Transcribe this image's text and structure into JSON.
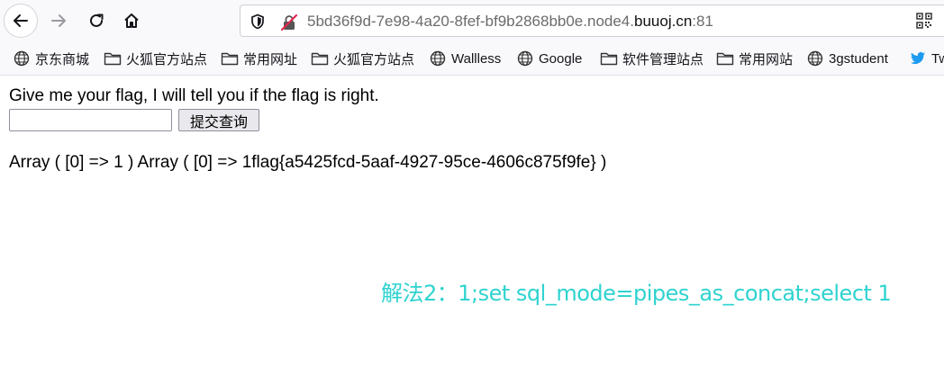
{
  "browser": {
    "url_prefix": "5bd36f9d-7e98-4a20-8fef-bf9b2868bb0e.node4.",
    "url_host": "buuoj.cn",
    "url_port": ":81",
    "icons": {
      "back": "arrow-left-icon",
      "forward": "arrow-right-icon",
      "reload": "reload-icon",
      "home": "home-icon",
      "tracking": "shield-icon",
      "insecure": "insecure-lock-icon",
      "qr": "qr-code-icon"
    }
  },
  "bookmarks": [
    {
      "label": "京东商城",
      "icon": "globe-icon"
    },
    {
      "label": "火狐官方站点",
      "icon": "folder-icon"
    },
    {
      "label": "常用网址",
      "icon": "folder-icon"
    },
    {
      "label": "火狐官方站点",
      "icon": "folder-icon"
    },
    {
      "label": "Wallless",
      "icon": "globe-icon"
    },
    {
      "label": "Google",
      "icon": "globe-icon"
    },
    {
      "label": "软件管理站点",
      "icon": "folder-icon"
    },
    {
      "label": "常用网站",
      "icon": "folder-icon"
    },
    {
      "label": "3gstudent",
      "icon": "globe-icon"
    },
    {
      "label": "Tw",
      "icon": "twitter-bird-icon"
    }
  ],
  "page": {
    "prompt": "Give me your flag, I will tell you if the flag is right.",
    "input_value": "",
    "submit_label": "提交查询",
    "result": "Array ( [0] => 1 ) Array ( [0] => 1flag{a5425fcd-5aaf-4927-95ce-4606c875f9fe} )",
    "note": "解法2：1;set sql_mode=pipes_as_concat;select 1",
    "note_color": "#2fd3cf"
  }
}
